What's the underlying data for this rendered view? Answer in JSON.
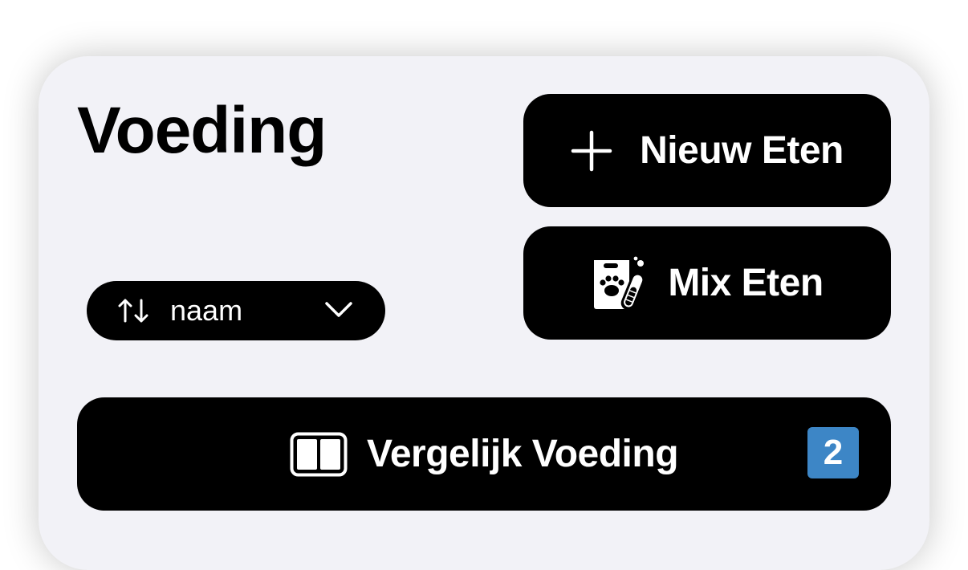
{
  "header": {
    "title": "Voeding"
  },
  "actions": {
    "new_food_label": "Nieuw Eten",
    "new_food_icon": "plus-icon",
    "mix_food_label": "Mix Eten",
    "mix_food_icon": "pet-food-mix-icon"
  },
  "sort": {
    "icon": "sort-arrows-icon",
    "value": "naam",
    "chevron": "chevron-down-icon"
  },
  "compare": {
    "label": "Vergelijk Voeding",
    "icon": "side-by-side-icon",
    "badge": "2",
    "badge_color": "#3d86c6"
  },
  "colors": {
    "card_background": "#f2f2f7",
    "button_background": "#000000",
    "button_text": "#ffffff"
  }
}
